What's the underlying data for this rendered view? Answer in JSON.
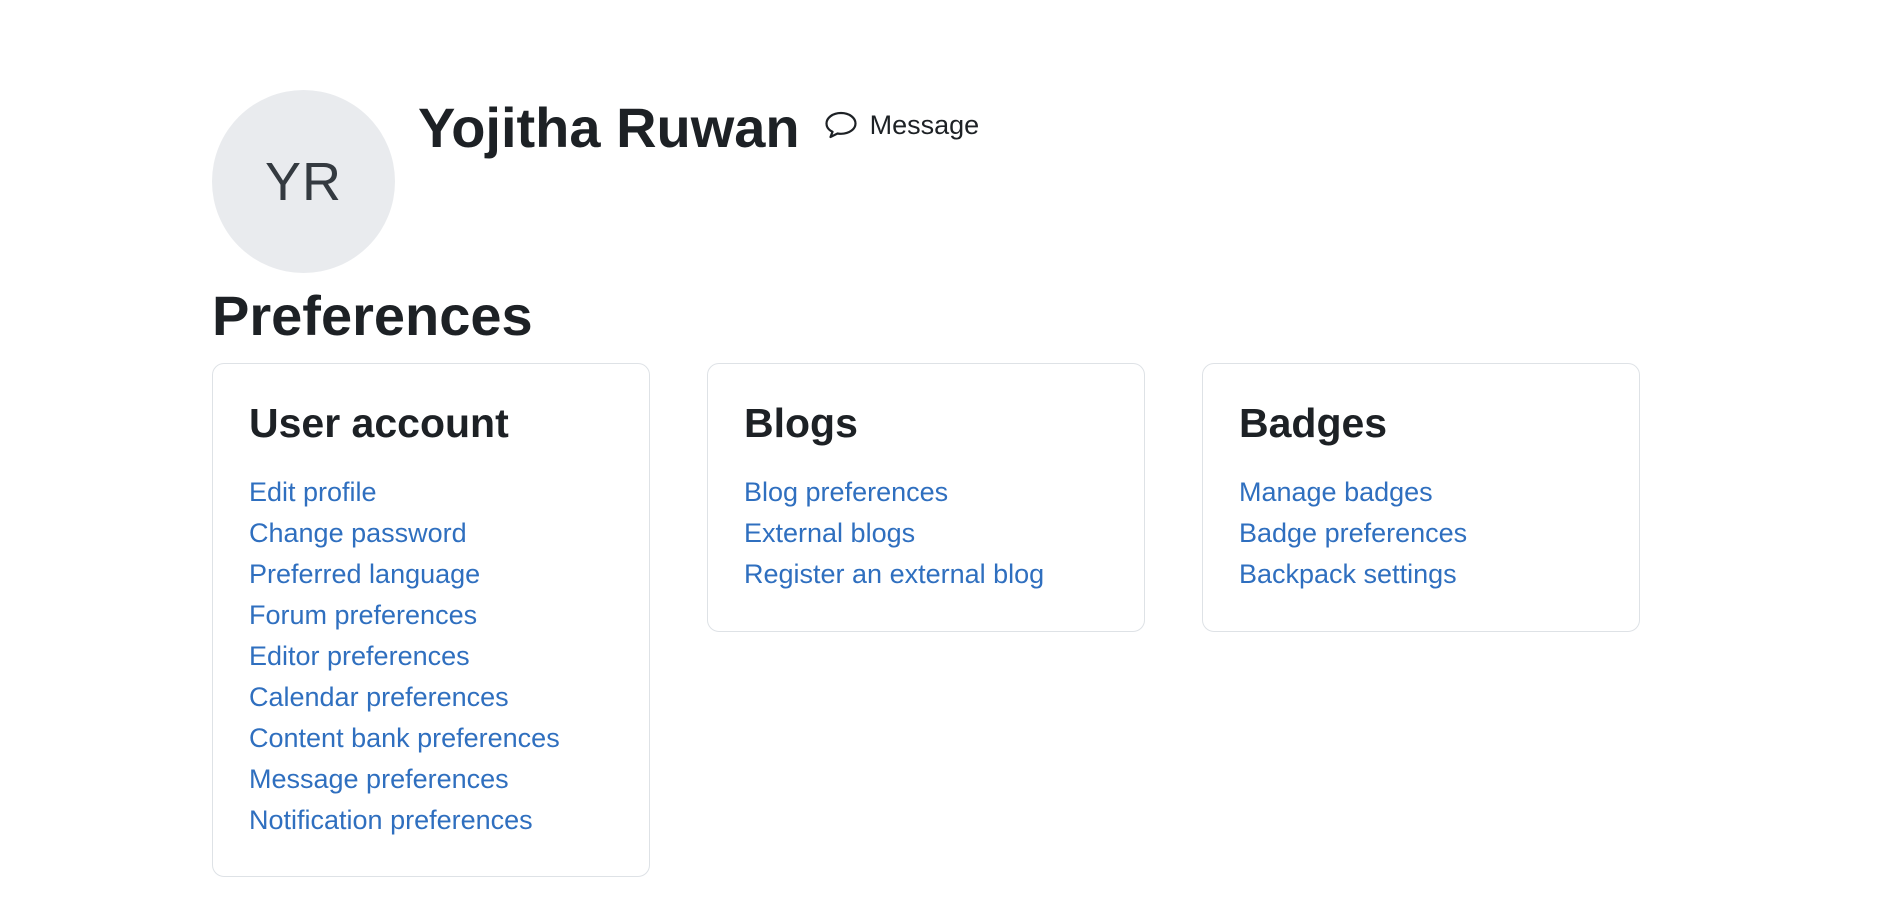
{
  "profile": {
    "avatar_initials": "YR",
    "name": "Yojitha Ruwan",
    "message_label": "Message",
    "message_icon": "speech-bubble-icon"
  },
  "page_title": "Preferences",
  "colors": {
    "link": "#2f6fbf",
    "text": "#1d2125",
    "avatar_bg": "#e9ebee",
    "card_border": "#dee2e6"
  },
  "cards": [
    {
      "title": "User account",
      "links": [
        "Edit profile",
        "Change password",
        "Preferred language",
        "Forum preferences",
        "Editor preferences",
        "Calendar preferences",
        "Content bank preferences",
        "Message preferences",
        "Notification preferences"
      ]
    },
    {
      "title": "Blogs",
      "links": [
        "Blog preferences",
        "External blogs",
        "Register an external blog"
      ]
    },
    {
      "title": "Badges",
      "links": [
        "Manage badges",
        "Badge preferences",
        "Backpack settings"
      ]
    }
  ]
}
